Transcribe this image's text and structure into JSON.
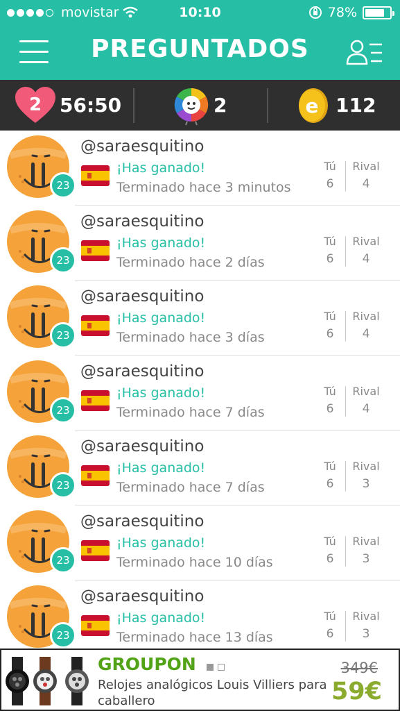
{
  "status_bar": {
    "carrier": "movistar",
    "time": "10:10",
    "battery": "78%",
    "battery_level": 0.78
  },
  "header": {
    "title": "PREGUNTADOS",
    "menu_icon": "hamburger-menu-icon",
    "profile_icon": "users-list-icon"
  },
  "stats": {
    "lives": "2",
    "timer": "56:50",
    "spins": "2",
    "coins": "112"
  },
  "columns": {
    "you": "Tú",
    "rival": "Rival"
  },
  "games": [
    {
      "username": "@saraesquitino",
      "level": "23",
      "result": "¡Has ganado!",
      "ended": "Terminado hace 3 minutos",
      "you": "6",
      "rival": "4"
    },
    {
      "username": "@saraesquitino",
      "level": "23",
      "result": "¡Has ganado!",
      "ended": "Terminado hace 2 días",
      "you": "6",
      "rival": "4"
    },
    {
      "username": "@saraesquitino",
      "level": "23",
      "result": "¡Has ganado!",
      "ended": "Terminado hace 3 días",
      "you": "6",
      "rival": "4"
    },
    {
      "username": "@saraesquitino",
      "level": "23",
      "result": "¡Has ganado!",
      "ended": "Terminado hace 7 días",
      "you": "6",
      "rival": "4"
    },
    {
      "username": "@saraesquitino",
      "level": "23",
      "result": "¡Has ganado!",
      "ended": "Terminado hace 7 días",
      "you": "6",
      "rival": "3"
    },
    {
      "username": "@saraesquitino",
      "level": "23",
      "result": "¡Has ganado!",
      "ended": "Terminado hace 10 días",
      "you": "6",
      "rival": "3"
    },
    {
      "username": "@saraesquitino",
      "level": "23",
      "result": "¡Has ganado!",
      "ended": "Terminado hace 13 días",
      "you": "6",
      "rival": "3"
    }
  ],
  "ad": {
    "brand": "GROUPON",
    "description": "Relojes analógicos Louis Villiers para caballero",
    "old_price": "349€",
    "price": "59€"
  },
  "colors": {
    "accent": "#26bfa5",
    "stats_bar": "#2f2f2f",
    "heart": "#f25a7a",
    "coin": "#f5c21b",
    "avatar": "#f6a23a",
    "groupon_green": "#53a318",
    "price_green": "#8aab2e"
  }
}
